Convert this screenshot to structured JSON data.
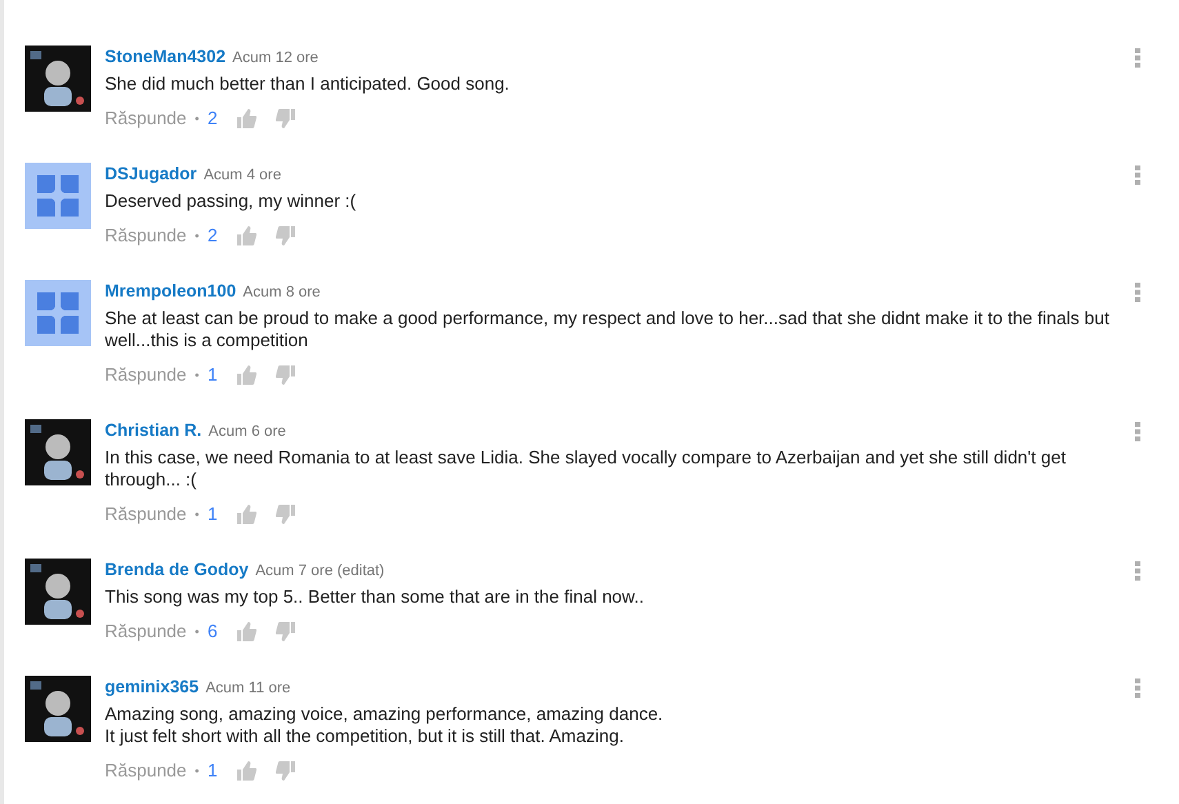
{
  "comments": [
    {
      "author": "StoneMan4302",
      "time": "Acum 12 ore",
      "avatar": {
        "kind": "picture"
      },
      "lines": [
        "She did much better than I anticipated. Good song."
      ],
      "reply": "Răspunde",
      "dot": "•",
      "likes": "2"
    },
    {
      "author": "DSJugador",
      "time": "Acum 4 ore",
      "avatar": {
        "kind": "default"
      },
      "lines": [
        "Deserved passing, my winner :("
      ],
      "reply": "Răspunde",
      "dot": "•",
      "likes": "2"
    },
    {
      "author": "Mrempoleon100",
      "time": "Acum 8 ore",
      "avatar": {
        "kind": "default"
      },
      "lines": [
        "She at least can be proud to make a good performance, my respect and love to her...sad that she didnt make it to the finals but well...this is a competition"
      ],
      "reply": "Răspunde",
      "dot": "•",
      "likes": "1"
    },
    {
      "author": "Christian R.",
      "time": "Acum 6 ore",
      "avatar": {
        "kind": "picture"
      },
      "lines": [
        "In this case, we need Romania to at least save Lidia. She slayed vocally compare to Azerbaijan and yet she still didn't get through... :("
      ],
      "reply": "Răspunde",
      "dot": "•",
      "likes": "1"
    },
    {
      "author": "Brenda de Godoy",
      "time": "Acum 7 ore (editat)",
      "avatar": {
        "kind": "picture"
      },
      "lines": [
        "This song was my top 5.. Better than some that are in the final now.."
      ],
      "reply": "Răspunde",
      "dot": "•",
      "likes": "6"
    },
    {
      "author": "geminix365",
      "time": "Acum 11 ore",
      "avatar": {
        "kind": "picture"
      },
      "lines": [
        "Amazing song, amazing voice, amazing performance, amazing dance.",
        "It just felt short with all the competition, but it is still that. Amazing."
      ],
      "reply": "Răspunde",
      "dot": "•",
      "likes": "1"
    }
  ]
}
